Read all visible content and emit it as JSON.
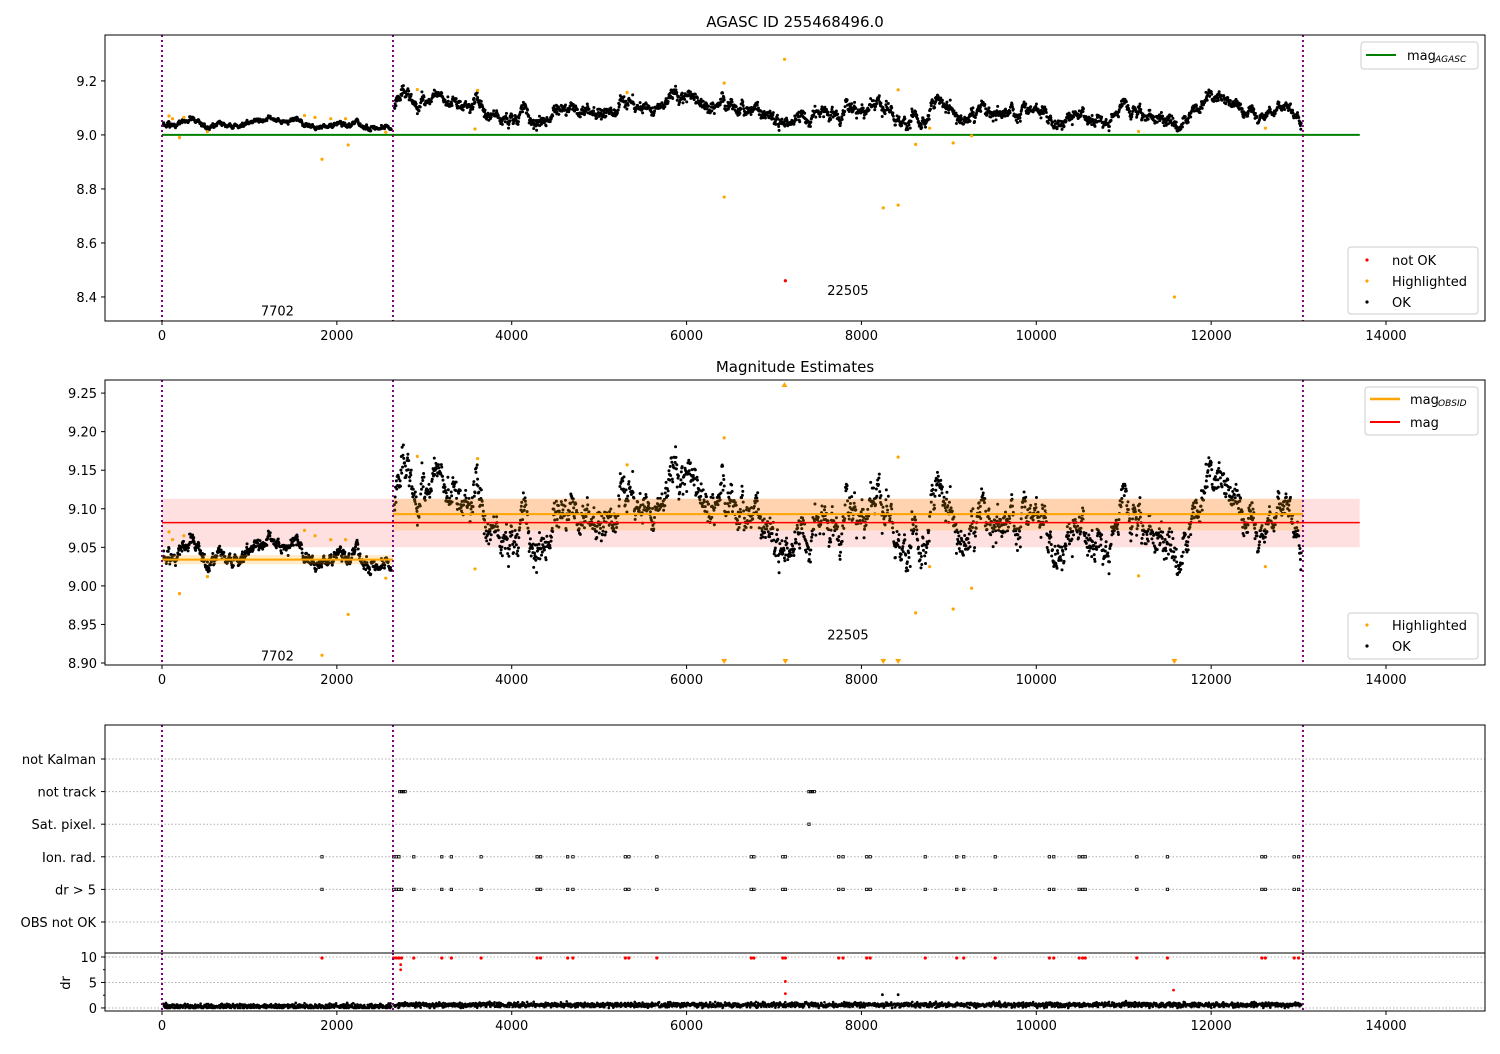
{
  "chart_data": [
    {
      "type": "scatter",
      "title": "AGASC ID 255468496.0",
      "xlim": [
        -652,
        15132
      ],
      "ylim": [
        8.311,
        9.37
      ],
      "xticks": [
        0,
        2000,
        4000,
        6000,
        8000,
        10000,
        12000,
        14000
      ],
      "yticks": [
        8.4,
        8.6,
        8.8,
        9.0,
        9.2
      ],
      "ytick_labels": [
        "8.4",
        "8.6",
        "8.8",
        "9.0",
        "9.2"
      ],
      "mag_agasc": {
        "label": "mag",
        "sub": "AGASC",
        "value": 9.0,
        "x_range": [
          0,
          13700
        ],
        "color": "#008000"
      },
      "obsid_boundaries": [
        0,
        2642,
        13050
      ],
      "obsid_labels": [
        {
          "text": "7702",
          "x": 1320,
          "y": 8.35
        },
        {
          "text": "22505",
          "x": 7846,
          "y": 8.425
        }
      ],
      "legend_series": [
        {
          "name": "not OK",
          "color": "#ff0000"
        },
        {
          "name": "Highlighted",
          "color": "#ffa500"
        },
        {
          "name": "OK",
          "color": "#000000"
        }
      ],
      "grid": false
    },
    {
      "type": "scatter",
      "title": "Magnitude Estimates",
      "xlim": [
        -652,
        15132
      ],
      "ylim": [
        8.8974,
        9.267
      ],
      "xticks": [
        0,
        2000,
        4000,
        6000,
        8000,
        10000,
        12000,
        14000
      ],
      "yticks": [
        8.9,
        8.95,
        9.0,
        9.05,
        9.1,
        9.15,
        9.2,
        9.25
      ],
      "ytick_labels": [
        "8.90",
        "8.95",
        "9.00",
        "9.05",
        "9.10",
        "9.15",
        "9.20",
        "9.25"
      ],
      "mag": {
        "label": "mag",
        "value": 9.082,
        "band": [
          9.05,
          9.113
        ],
        "x_range": [
          0,
          13700
        ],
        "color": "#ff0000"
      },
      "mag_obsid": {
        "label": "mag",
        "sub": "OBSID",
        "color": "#ffa500",
        "segments": [
          {
            "x_range": [
              0,
              2642
            ],
            "value": 9.034,
            "band": [
              9.028,
              9.04
            ]
          },
          {
            "x_range": [
              2642,
              13050
            ],
            "value": 9.093,
            "band": [
              9.072,
              9.113
            ]
          }
        ]
      },
      "obsid_labels": [
        {
          "text": "7702",
          "x": 1320,
          "y": 8.91
        },
        {
          "text": "22505",
          "x": 7846,
          "y": 8.937
        }
      ],
      "legend_series": [
        {
          "name": "Highlighted",
          "color": "#ffa500"
        },
        {
          "name": "OK",
          "color": "#000000"
        }
      ],
      "grid": false
    },
    {
      "type": "scatter",
      "title": "",
      "categories": [
        "not Kalman",
        "not track",
        "Sat. pixel.",
        "Ion. rad.",
        "dr > 5",
        "OBS not OK"
      ],
      "flags": {
        "not track": [
          2720,
          2740,
          2760,
          2780,
          7400,
          7420,
          7440,
          7460
        ],
        "Sat. pixel.": [
          7400
        ],
        "Ion. rad.": [
          1830,
          2650,
          2680,
          2710,
          2880,
          3200,
          3310,
          3650,
          4290,
          4330,
          4640,
          4700,
          5300,
          5340,
          5660,
          6740,
          6770,
          7100,
          7130,
          7740,
          7790,
          8060,
          8100,
          8730,
          9090,
          9170,
          9530,
          10150,
          10200,
          10490,
          10530,
          10560,
          11150,
          11500,
          12580,
          12620,
          12950,
          13000
        ],
        "dr > 5": [
          1830,
          2650,
          2680,
          2710,
          2740,
          2880,
          3200,
          3310,
          3650,
          4290,
          4330,
          4640,
          4700,
          5300,
          5340,
          5660,
          6740,
          6770,
          7100,
          7130,
          7740,
          7790,
          8060,
          8100,
          8730,
          9090,
          9170,
          9530,
          10150,
          10200,
          10490,
          10530,
          10560,
          11150,
          11500,
          12580,
          12620,
          12950,
          13000
        ]
      }
    },
    {
      "type": "scatter",
      "ylabel": "dr",
      "xlim": [
        -652,
        15132
      ],
      "ylim": [
        -0.6,
        10.78
      ],
      "yticks": [
        0,
        5,
        10
      ],
      "ytick_labels": [
        "0",
        "5",
        "10"
      ],
      "xticks": [
        0,
        2000,
        4000,
        6000,
        8000,
        10000,
        12000,
        14000
      ],
      "red_extra": [
        [
          2730,
          8.5
        ],
        [
          2730,
          7.5
        ],
        [
          7130,
          5.2
        ],
        [
          7130,
          2.8
        ],
        [
          11570,
          3.5
        ]
      ],
      "black_extra": [
        [
          8240,
          2.6
        ],
        [
          8420,
          2.6
        ]
      ]
    }
  ],
  "ok_segments": [
    {
      "x_range": [
        0,
        2642
      ],
      "mean_start": 9.037,
      "mean_end": 9.036,
      "spread": 0.008,
      "n": 600,
      "dr_mean": 0.3
    },
    {
      "x_range": [
        2642,
        13050
      ],
      "mean_start": 9.108,
      "mean_end": 9.075,
      "spread": 0.02,
      "n": 2200,
      "dr_mean": 0.6
    }
  ],
  "highlighted": [
    [
      80,
      9.07
    ],
    [
      120,
      9.06
    ],
    [
      200,
      8.99
    ],
    [
      250,
      9.065
    ],
    [
      520,
      9.012
    ],
    [
      1630,
      9.072
    ],
    [
      1750,
      9.065
    ],
    [
      1830,
      8.91
    ],
    [
      1930,
      9.06
    ],
    [
      2100,
      9.06
    ],
    [
      2130,
      8.963
    ],
    [
      2560,
      9.01
    ],
    [
      2920,
      9.168
    ],
    [
      3580,
      9.022
    ],
    [
      3610,
      9.165
    ],
    [
      5320,
      9.157
    ],
    [
      6430,
      9.192
    ],
    [
      6430,
      8.77
    ],
    [
      7120,
      9.28
    ],
    [
      8250,
      8.73
    ],
    [
      8420,
      9.167
    ],
    [
      8420,
      8.74
    ],
    [
      8780,
      9.025
    ],
    [
      8620,
      8.965
    ],
    [
      9050,
      8.97
    ],
    [
      9260,
      8.997
    ],
    [
      11170,
      9.013
    ],
    [
      11580,
      8.4
    ],
    [
      12620,
      9.025
    ]
  ],
  "not_ok": [
    [
      7130,
      8.46
    ]
  ]
}
